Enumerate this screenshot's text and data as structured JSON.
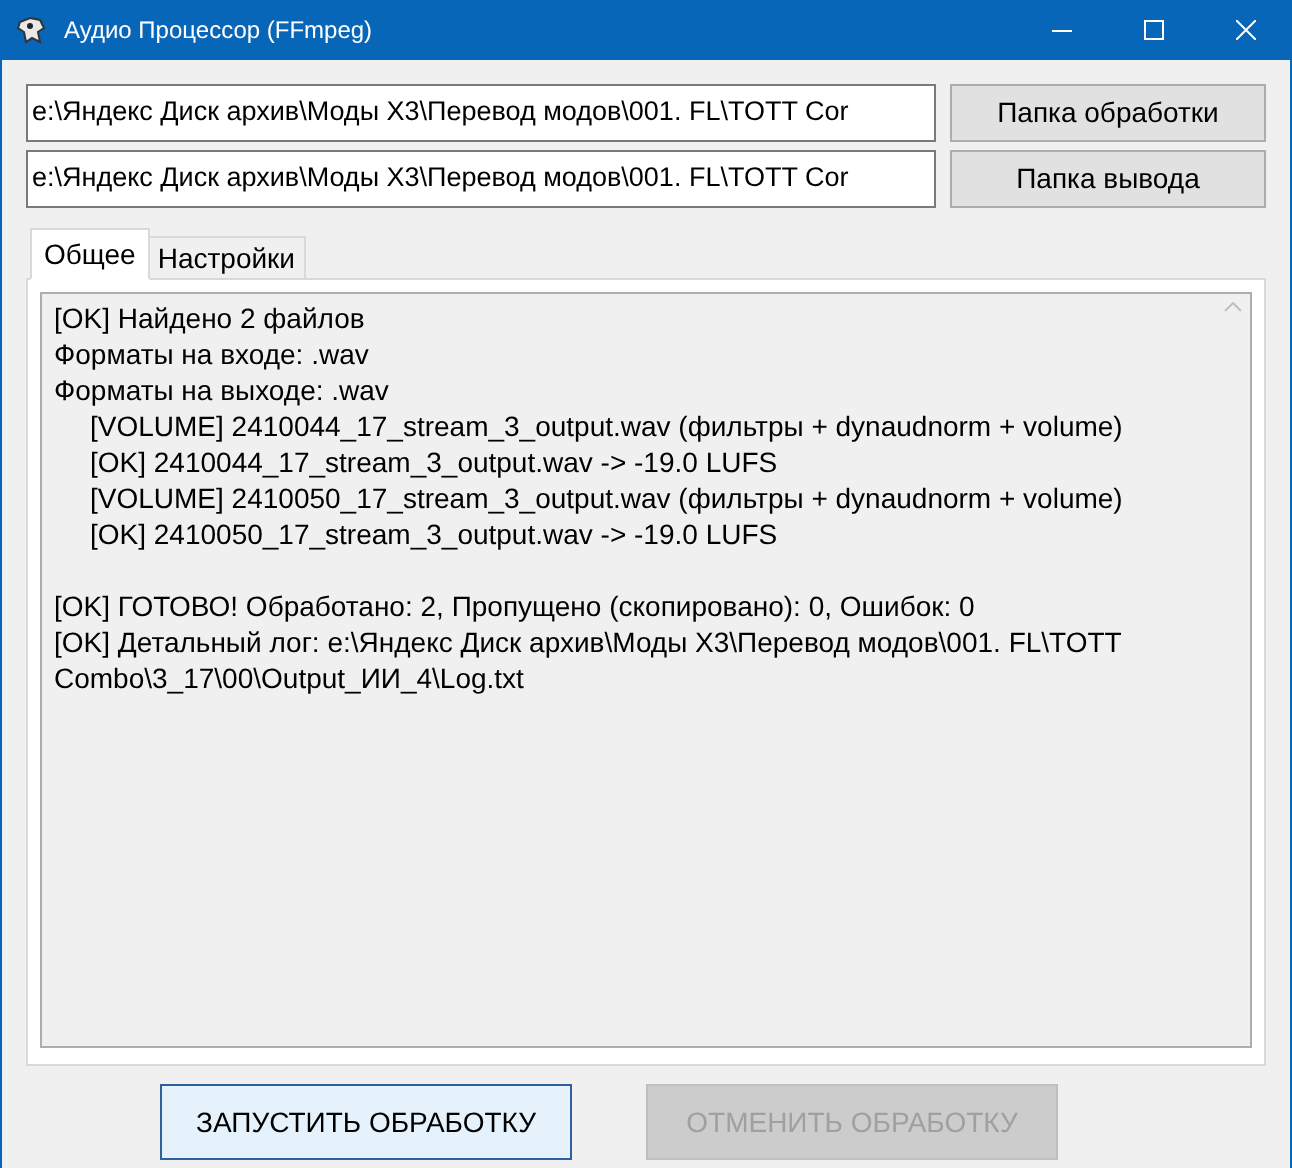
{
  "window": {
    "title": "Аудио Процессор (FFmpeg)"
  },
  "folders": [
    {
      "value": "e:\\Яндекс Диск архив\\Моды X3\\Перевод модов\\001. FL\\TOTT Cor",
      "button": "Папка обработки"
    },
    {
      "value": "e:\\Яндекс Диск архив\\Моды X3\\Перевод модов\\001. FL\\TOTT Cor",
      "button": "Папка вывода"
    }
  ],
  "tabs": [
    {
      "label": "Общее",
      "selected": true
    },
    {
      "label": "Настройки",
      "selected": false
    }
  ],
  "log": {
    "groups": [
      {
        "lines": [
          {
            "text": "[OK] Найдено 2 файлов",
            "indented": false
          },
          {
            "text": "Форматы на входе: .wav",
            "indented": false
          },
          {
            "text": "Форматы на выходе: .wav",
            "indented": false
          },
          {
            "text": "[VOLUME] 2410044_17_stream_3_output.wav (фильтры + dynaudnorm + volume)",
            "indented": true
          },
          {
            "text": "[OK] 2410044_17_stream_3_output.wav -> -19.0 LUFS",
            "indented": true
          },
          {
            "text": "[VOLUME] 2410050_17_stream_3_output.wav (фильтры + dynaudnorm + volume)",
            "indented": true
          },
          {
            "text": "[OK] 2410050_17_stream_3_output.wav -> -19.0 LUFS",
            "indented": true
          }
        ]
      },
      {
        "lines": [
          {
            "text": "[OK] ГОТОВО! Обработано: 2, Пропущено (скопировано): 0, Ошибок: 0",
            "indented": false
          },
          {
            "text": "[OK] Детальный лог: e:\\Яндекс Диск архив\\Моды X3\\Перевод модов\\001. FL\\TOTT Combo\\3_17\\00\\Output_ИИ_4\\Log.txt",
            "indented": false
          }
        ]
      }
    ]
  },
  "buttons": [
    {
      "label": "ЗАПУСТИТЬ ОБРАБОТКУ",
      "disabled": false
    },
    {
      "label": "ОТМЕНИТЬ ОБРАБОТКУ",
      "disabled": true
    }
  ]
}
